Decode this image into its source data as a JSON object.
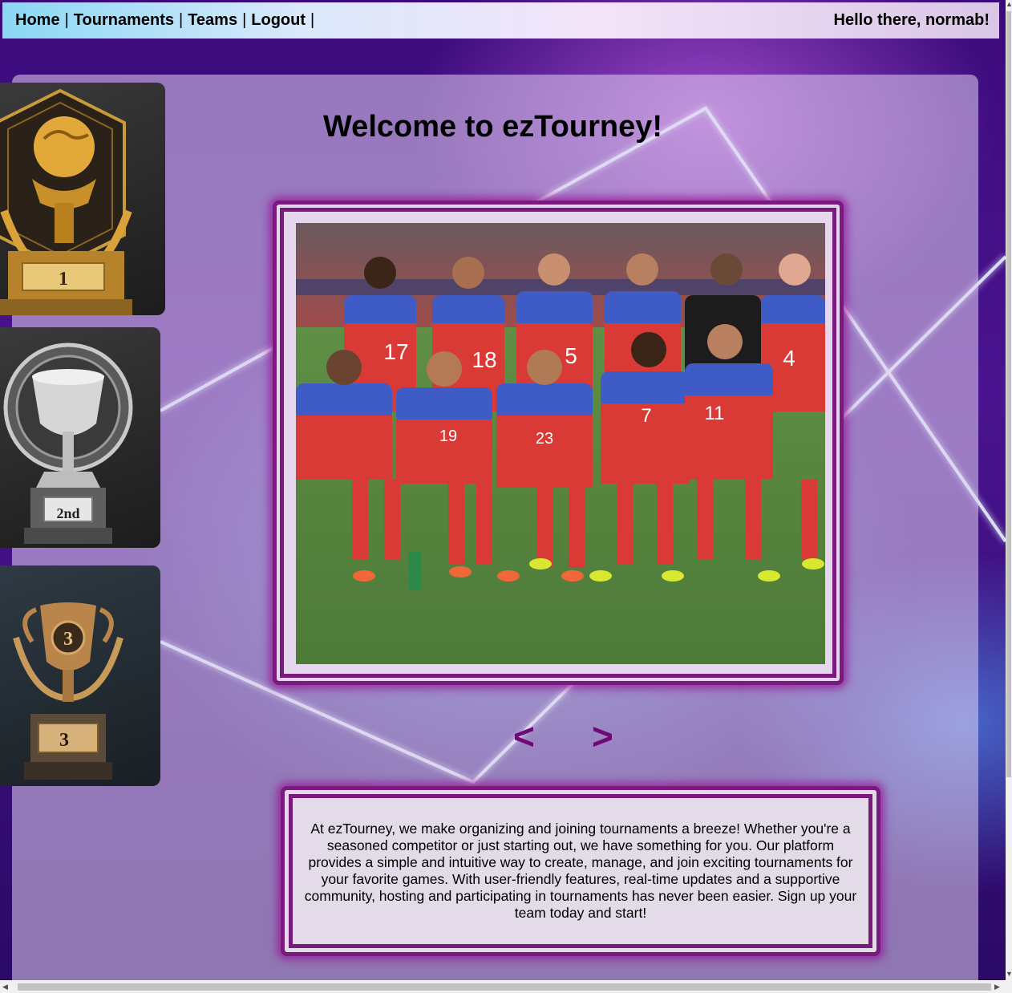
{
  "nav": {
    "links": [
      "Home",
      "Tournaments",
      "Teams",
      "Logout"
    ],
    "separator": "|",
    "greeting": "Hello there, normab!"
  },
  "main": {
    "title": "Welcome to ezTourney!",
    "prev_label": "<",
    "next_label": ">",
    "description": "At ezTourney, we make organizing and joining tournaments a breeze! Whether you're a seasoned competitor or just starting out, we have something for you. Our platform provides a simple and intuitive way to create, manage, and join exciting tournaments for your favorite games. With user-friendly features, real-time updates and a supportive community, hosting and participating in tournaments has never been easier. Sign up your team today and start!"
  },
  "trophies": {
    "first_label": "1",
    "second_label": "2nd",
    "third_label": "3"
  },
  "photo": {
    "jersey_numbers": [
      "17",
      "18",
      "5",
      "4",
      "19",
      "23",
      "7",
      "11"
    ]
  },
  "colors": {
    "accent": "#7a1a7e",
    "arrow": "#6e0a78"
  }
}
